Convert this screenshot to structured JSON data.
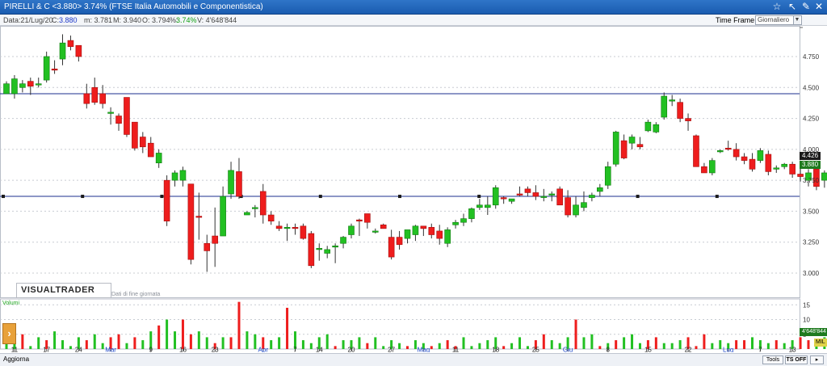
{
  "window": {
    "title": "PIRELLI & C <3.880> 3.74%  (FTSE Italia Automobili e Componentistica)"
  },
  "infobar": {
    "date": "Data:21/Lug/20",
    "close_label": "C:",
    "close": "3.880",
    "min": "m: 3.781",
    "max": "M: 3.940",
    "open": "O: 3.794",
    "pct_label": "%:",
    "pct": "3.74%",
    "volume": "V: 4'648'844",
    "timeframe_label": "Time Frame",
    "timeframe_value": "Giornaliero"
  },
  "branding": {
    "logo": "VISUALTRADER",
    "subtitle": "Dati di fine giornata"
  },
  "volume_panel": {
    "label": "Volumi",
    "current_value": "4'648'844",
    "unit_tag": "MIL"
  },
  "price_badges": {
    "high": "4.426",
    "last": "3.880"
  },
  "bottombar": {
    "aggiorna": "Aggiorna",
    "tools": "Tools",
    "ts_off": "TS OFF"
  },
  "colors": {
    "up": "#22c022",
    "down": "#ee1d1d",
    "line": "#1b2f8f",
    "titlebar": "#1f63b8"
  },
  "chart_data": {
    "type": "candlestick",
    "y_axis": {
      "range": [
        2.85,
        5.0
      ],
      "ticks": [
        3.0,
        3.25,
        3.5,
        3.75,
        4.0,
        4.25,
        4.5,
        4.75
      ],
      "tick_labels": [
        "3.000",
        "3.250",
        "3.500",
        "3.750",
        "4.000",
        "4.250",
        "4.500",
        "4.750"
      ],
      "position": "right",
      "grid": true
    },
    "x_axis": {
      "labels": [
        {
          "label": "11",
          "i": 1
        },
        {
          "label": "17",
          "i": 5
        },
        {
          "label": "24",
          "i": 9
        },
        {
          "label": "Mar",
          "i": 13,
          "month": true
        },
        {
          "label": "9",
          "i": 18
        },
        {
          "label": "16",
          "i": 22
        },
        {
          "label": "23",
          "i": 26
        },
        {
          "label": "Apr",
          "i": 32,
          "month": true
        },
        {
          "label": "7",
          "i": 36
        },
        {
          "label": "14",
          "i": 39
        },
        {
          "label": "20",
          "i": 43
        },
        {
          "label": "27",
          "i": 48
        },
        {
          "label": "Mag",
          "i": 52,
          "month": true
        },
        {
          "label": "11",
          "i": 56
        },
        {
          "label": "18",
          "i": 61
        },
        {
          "label": "25",
          "i": 66
        },
        {
          "label": "Giu",
          "i": 70,
          "month": true
        },
        {
          "label": "8",
          "i": 75
        },
        {
          "label": "15",
          "i": 80
        },
        {
          "label": "22",
          "i": 85
        },
        {
          "label": "Lug",
          "i": 90,
          "month": true
        },
        {
          "label": "7",
          "i": 94
        },
        {
          "label": "13",
          "i": 98
        },
        {
          "label": "20",
          "i": 103
        }
      ]
    },
    "horizontal_lines": [
      4.45,
      3.62
    ],
    "volume_axis": {
      "ticks": [
        5,
        10,
        15
      ],
      "range": [
        0,
        17
      ]
    },
    "candles": [
      {
        "o": 4.45,
        "h": 4.55,
        "l": 4.45,
        "c": 4.53
      },
      {
        "o": 4.45,
        "h": 4.6,
        "l": 4.41,
        "c": 4.57
      },
      {
        "o": 4.5,
        "h": 4.56,
        "l": 4.46,
        "c": 4.53
      },
      {
        "o": 4.55,
        "h": 4.58,
        "l": 4.44,
        "c": 4.51
      },
      {
        "o": 4.53,
        "h": 4.58,
        "l": 4.5,
        "c": 4.53
      },
      {
        "o": 4.56,
        "h": 4.79,
        "l": 4.54,
        "c": 4.75
      },
      {
        "o": 4.65,
        "h": 4.72,
        "l": 4.61,
        "c": 4.64
      },
      {
        "o": 4.73,
        "h": 4.93,
        "l": 4.68,
        "c": 4.86
      },
      {
        "o": 4.88,
        "h": 4.92,
        "l": 4.8,
        "c": 4.83
      },
      {
        "o": 4.84,
        "h": 4.84,
        "l": 4.71,
        "c": 4.75
      },
      {
        "o": 4.45,
        "h": 4.53,
        "l": 4.33,
        "c": 4.37
      },
      {
        "o": 4.5,
        "h": 4.58,
        "l": 4.36,
        "c": 4.38
      },
      {
        "o": 4.45,
        "h": 4.52,
        "l": 4.33,
        "c": 4.37
      },
      {
        "o": 4.3,
        "h": 4.34,
        "l": 4.2,
        "c": 4.3
      },
      {
        "o": 4.27,
        "h": 4.29,
        "l": 4.15,
        "c": 4.21
      },
      {
        "o": 4.42,
        "h": 4.42,
        "l": 4.1,
        "c": 4.12
      },
      {
        "o": 4.22,
        "h": 4.22,
        "l": 3.99,
        "c": 4.01
      },
      {
        "o": 4.1,
        "h": 4.14,
        "l": 3.97,
        "c": 4.02
      },
      {
        "o": 4.05,
        "h": 4.1,
        "l": 3.95,
        "c": 3.94
      },
      {
        "o": 3.89,
        "h": 4.0,
        "l": 3.85,
        "c": 3.97
      },
      {
        "o": 3.75,
        "h": 3.79,
        "l": 3.38,
        "c": 3.42
      },
      {
        "o": 3.75,
        "h": 3.83,
        "l": 3.7,
        "c": 3.81
      },
      {
        "o": 3.75,
        "h": 3.86,
        "l": 3.7,
        "c": 3.83
      },
      {
        "o": 3.72,
        "h": 3.72,
        "l": 3.07,
        "c": 3.11
      },
      {
        "o": 3.46,
        "h": 3.65,
        "l": 3.27,
        "c": 3.45
      },
      {
        "o": 3.24,
        "h": 3.31,
        "l": 3.01,
        "c": 3.18
      },
      {
        "o": 3.3,
        "h": 3.53,
        "l": 3.05,
        "c": 3.24
      },
      {
        "o": 3.3,
        "h": 3.7,
        "l": 3.3,
        "c": 3.62
      },
      {
        "o": 3.64,
        "h": 3.9,
        "l": 3.6,
        "c": 3.83
      },
      {
        "o": 3.82,
        "h": 3.93,
        "l": 3.6,
        "c": 3.62
      },
      {
        "o": 3.47,
        "h": 3.5,
        "l": 3.47,
        "c": 3.49
      },
      {
        "o": 3.52,
        "h": 3.55,
        "l": 3.45,
        "c": 3.53
      },
      {
        "o": 3.66,
        "h": 3.72,
        "l": 3.4,
        "c": 3.47
      },
      {
        "o": 3.47,
        "h": 3.5,
        "l": 3.39,
        "c": 3.42
      },
      {
        "o": 3.38,
        "h": 3.42,
        "l": 3.34,
        "c": 3.36
      },
      {
        "o": 3.37,
        "h": 3.4,
        "l": 3.26,
        "c": 3.37
      },
      {
        "o": 3.37,
        "h": 3.4,
        "l": 3.31,
        "c": 3.36
      },
      {
        "o": 3.38,
        "h": 3.4,
        "l": 3.27,
        "c": 3.28
      },
      {
        "o": 3.32,
        "h": 3.34,
        "l": 3.04,
        "c": 3.06
      },
      {
        "o": 3.19,
        "h": 3.24,
        "l": 3.1,
        "c": 3.2
      },
      {
        "o": 3.16,
        "h": 3.22,
        "l": 3.12,
        "c": 3.19
      },
      {
        "o": 3.21,
        "h": 3.24,
        "l": 3.08,
        "c": 3.22
      },
      {
        "o": 3.24,
        "h": 3.3,
        "l": 3.2,
        "c": 3.29
      },
      {
        "o": 3.31,
        "h": 3.4,
        "l": 3.28,
        "c": 3.38
      },
      {
        "o": 3.43,
        "h": 3.44,
        "l": 3.3,
        "c": 3.42
      },
      {
        "o": 3.48,
        "h": 3.48,
        "l": 3.36,
        "c": 3.41
      },
      {
        "o": 3.34,
        "h": 3.36,
        "l": 3.32,
        "c": 3.34
      },
      {
        "o": 3.39,
        "h": 3.4,
        "l": 3.36,
        "c": 3.36
      },
      {
        "o": 3.29,
        "h": 3.35,
        "l": 3.11,
        "c": 3.13
      },
      {
        "o": 3.29,
        "h": 3.34,
        "l": 3.19,
        "c": 3.23
      },
      {
        "o": 3.28,
        "h": 3.34,
        "l": 3.24,
        "c": 3.35
      },
      {
        "o": 3.31,
        "h": 3.39,
        "l": 3.26,
        "c": 3.38
      },
      {
        "o": 3.38,
        "h": 3.38,
        "l": 3.3,
        "c": 3.36
      },
      {
        "o": 3.37,
        "h": 3.4,
        "l": 3.28,
        "c": 3.31
      },
      {
        "o": 3.34,
        "h": 3.39,
        "l": 3.23,
        "c": 3.28
      },
      {
        "o": 3.24,
        "h": 3.37,
        "l": 3.21,
        "c": 3.35
      },
      {
        "o": 3.39,
        "h": 3.43,
        "l": 3.36,
        "c": 3.41
      },
      {
        "o": 3.41,
        "h": 3.48,
        "l": 3.38,
        "c": 3.44
      },
      {
        "o": 3.44,
        "h": 3.53,
        "l": 3.41,
        "c": 3.52
      },
      {
        "o": 3.53,
        "h": 3.6,
        "l": 3.51,
        "c": 3.55
      },
      {
        "o": 3.53,
        "h": 3.62,
        "l": 3.47,
        "c": 3.55
      },
      {
        "o": 3.55,
        "h": 3.71,
        "l": 3.52,
        "c": 3.69
      },
      {
        "o": 3.61,
        "h": 3.62,
        "l": 3.56,
        "c": 3.6
      },
      {
        "o": 3.58,
        "h": 3.6,
        "l": 3.56,
        "c": 3.6
      },
      {
        "o": 3.64,
        "h": 3.7,
        "l": 3.62,
        "c": 3.63
      },
      {
        "o": 3.68,
        "h": 3.7,
        "l": 3.62,
        "c": 3.65
      },
      {
        "o": 3.65,
        "h": 3.71,
        "l": 3.59,
        "c": 3.62
      },
      {
        "o": 3.62,
        "h": 3.68,
        "l": 3.58,
        "c": 3.62
      },
      {
        "o": 3.63,
        "h": 3.66,
        "l": 3.58,
        "c": 3.64
      },
      {
        "o": 3.68,
        "h": 3.7,
        "l": 3.6,
        "c": 3.55
      },
      {
        "o": 3.61,
        "h": 3.67,
        "l": 3.45,
        "c": 3.47
      },
      {
        "o": 3.47,
        "h": 3.62,
        "l": 3.45,
        "c": 3.55
      },
      {
        "o": 3.53,
        "h": 3.66,
        "l": 3.5,
        "c": 3.57
      },
      {
        "o": 3.61,
        "h": 3.65,
        "l": 3.58,
        "c": 3.63
      },
      {
        "o": 3.66,
        "h": 3.72,
        "l": 3.62,
        "c": 3.69
      },
      {
        "o": 3.71,
        "h": 3.9,
        "l": 3.68,
        "c": 3.86
      },
      {
        "o": 3.88,
        "h": 4.15,
        "l": 3.86,
        "c": 4.14
      },
      {
        "o": 4.07,
        "h": 4.12,
        "l": 3.92,
        "c": 3.93
      },
      {
        "o": 4.05,
        "h": 4.12,
        "l": 4.0,
        "c": 4.1
      },
      {
        "o": 4.04,
        "h": 4.1,
        "l": 4.0,
        "c": 4.02
      },
      {
        "o": 4.15,
        "h": 4.24,
        "l": 4.14,
        "c": 4.22
      },
      {
        "o": 4.14,
        "h": 4.22,
        "l": 4.13,
        "c": 4.2
      },
      {
        "o": 4.26,
        "h": 4.46,
        "l": 4.24,
        "c": 4.43
      },
      {
        "o": 4.39,
        "h": 4.44,
        "l": 4.35,
        "c": 4.4
      },
      {
        "o": 4.38,
        "h": 4.41,
        "l": 4.22,
        "c": 4.25
      },
      {
        "o": 4.25,
        "h": 4.29,
        "l": 4.15,
        "c": 4.23
      },
      {
        "o": 4.11,
        "h": 4.12,
        "l": 3.86,
        "c": 3.86
      },
      {
        "o": 3.86,
        "h": 3.89,
        "l": 3.81,
        "c": 3.81
      },
      {
        "o": 3.81,
        "h": 3.93,
        "l": 3.79,
        "c": 3.91
      },
      {
        "o": 3.98,
        "h": 4.0,
        "l": 3.97,
        "c": 3.99
      },
      {
        "o": 4.01,
        "h": 4.07,
        "l": 3.99,
        "c": 4.0
      },
      {
        "o": 4.0,
        "h": 4.05,
        "l": 3.91,
        "c": 3.94
      },
      {
        "o": 3.94,
        "h": 3.97,
        "l": 3.88,
        "c": 3.91
      },
      {
        "o": 3.92,
        "h": 3.97,
        "l": 3.82,
        "c": 3.84
      },
      {
        "o": 3.91,
        "h": 4.01,
        "l": 3.89,
        "c": 3.99
      },
      {
        "o": 3.96,
        "h": 3.99,
        "l": 3.79,
        "c": 3.82
      },
      {
        "o": 3.84,
        "h": 3.87,
        "l": 3.81,
        "c": 3.85
      },
      {
        "o": 3.86,
        "h": 3.89,
        "l": 3.84,
        "c": 3.88
      },
      {
        "o": 3.88,
        "h": 3.9,
        "l": 3.77,
        "c": 3.8
      },
      {
        "o": 3.8,
        "h": 3.86,
        "l": 3.74,
        "c": 3.78
      },
      {
        "o": 3.75,
        "h": 3.84,
        "l": 3.7,
        "c": 3.81
      },
      {
        "o": 3.84,
        "h": 3.86,
        "l": 3.67,
        "c": 3.7
      },
      {
        "o": 3.75,
        "h": 3.83,
        "l": 3.69,
        "c": 3.81
      },
      {
        "o": 3.79,
        "h": 3.82,
        "l": 3.76,
        "c": 3.79
      }
    ],
    "volumes": [
      4,
      2,
      5,
      1,
      4,
      3,
      6,
      3,
      1,
      4,
      3,
      5,
      2,
      4,
      5,
      2,
      4,
      3,
      6,
      8,
      10,
      6,
      10,
      5,
      6,
      4,
      2,
      4,
      4,
      16,
      6,
      5,
      4,
      3,
      4,
      14,
      6,
      3,
      2,
      4,
      5,
      1,
      3,
      3,
      4,
      2,
      4,
      1,
      3,
      2,
      1,
      3,
      2,
      1,
      2,
      3,
      1,
      4,
      1,
      2,
      3,
      4,
      1,
      2,
      4,
      1,
      3,
      5,
      3,
      2,
      4,
      10,
      4,
      5,
      1,
      2,
      3,
      4,
      5,
      2,
      3,
      4,
      2,
      2,
      3,
      4,
      1,
      5,
      2,
      3,
      2,
      3,
      3,
      4,
      3,
      2,
      3,
      2,
      3,
      4,
      3,
      2,
      4,
      5
    ],
    "volume_up_mask": [
      1,
      1,
      0,
      1,
      1,
      0,
      1,
      1,
      1,
      1,
      0,
      1,
      1,
      0,
      0,
      1,
      0,
      1,
      1,
      0,
      1,
      1,
      0,
      0,
      1,
      1,
      0,
      1,
      0,
      0,
      1,
      1,
      0,
      1,
      1,
      0,
      1,
      1,
      1,
      1,
      1,
      0,
      1,
      1,
      1,
      0,
      1,
      1,
      1,
      1,
      0,
      1,
      1,
      0,
      1,
      0,
      0,
      1,
      1,
      1,
      1,
      1,
      0,
      1,
      1,
      1,
      0,
      0,
      1,
      1,
      1,
      0,
      1,
      1,
      0,
      1,
      0,
      1,
      1,
      1,
      0,
      0,
      1,
      1,
      1,
      0,
      0,
      0,
      1,
      1,
      1,
      0,
      0,
      1,
      1,
      1,
      0,
      1,
      1,
      0,
      0,
      1,
      1,
      1
    ]
  }
}
